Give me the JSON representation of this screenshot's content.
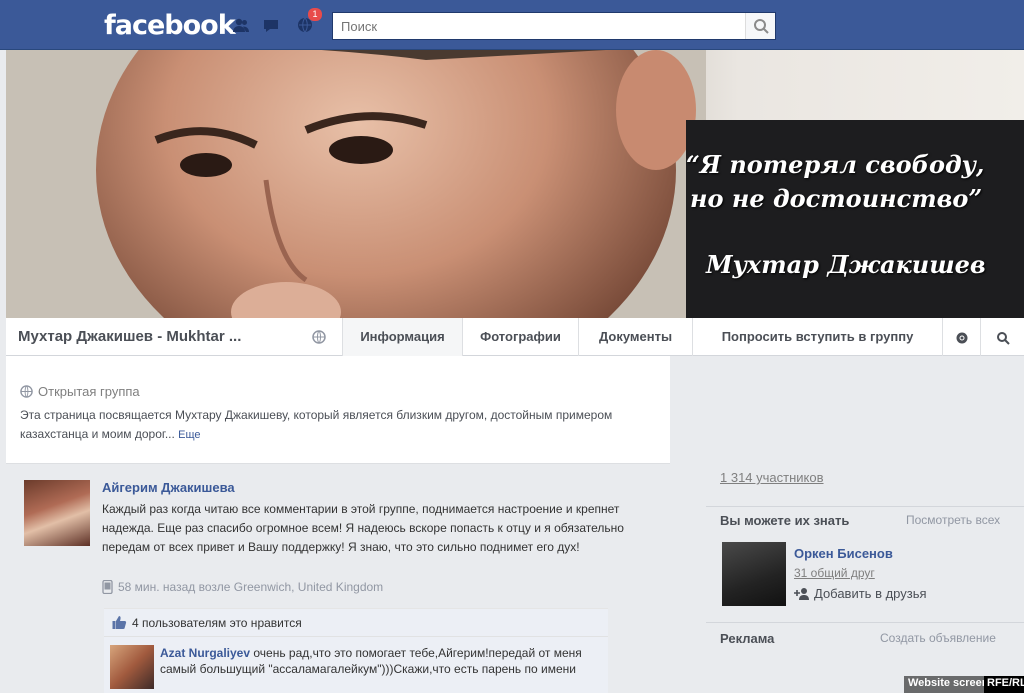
{
  "topbar": {
    "logo": "facebook",
    "notifications_count": "1",
    "search_placeholder": "Поиск",
    "icons": [
      "friends-icon",
      "messages-icon",
      "notifications-icon",
      "search-icon"
    ],
    "color": "#3b5998"
  },
  "cover": {
    "quote_line1": "“Я потерял свободу,",
    "quote_line2": "но не достоинство”",
    "quote_author": "Мухтар Джакишев"
  },
  "group": {
    "name": "Мухтар Джакишев - Mukhtar ...",
    "tabs": {
      "info": "Информация",
      "photos": "Фотографии",
      "docs": "Документы",
      "join": "Попросить вступить в группу"
    }
  },
  "about": {
    "privacy": "Открытая группа",
    "text": "Эта страница посвящается Мухтару Джакишеву, который является близким другом, достойным примером казахстанца и моим дорог...",
    "more": "Еще"
  },
  "post": {
    "author": "Айгерим Джакишева",
    "text": "Каждый раз когда читаю все комментарии в этой группе, поднимается настроение и крепнет надежда. Еще раз спасибо огромное всем! Я надеюсь вскоре попасть к отцу и я обязательно передам от всех привет и Вашу поддержку! Я знаю, что это сильно поднимет его дух!",
    "meta": "58 мин. назад возле Greenwich, United Kingdom",
    "likes": "4 пользователям это нравится",
    "comment": {
      "author": "Azat Nurgaliyev",
      "text": "очень рад,что это помогает тебе,Айгерим!передай от меня самый большущий \"ассаламагалейкум\")))Скажи,что есть парень по имени"
    }
  },
  "sidebar": {
    "members": "1 314 участников",
    "pymk_title": "Вы можете их знать",
    "pymk_see_all": "Посмотреть всех",
    "pymk_name": "Оркен Бисенов",
    "pymk_mutual": "31 общий друг",
    "pymk_add": "Добавить в друзья",
    "ads_title": "Реклама",
    "ads_create": "Создать объявление"
  },
  "watermark": {
    "text": "Website screenshot",
    "brand": "RFE/RL"
  }
}
